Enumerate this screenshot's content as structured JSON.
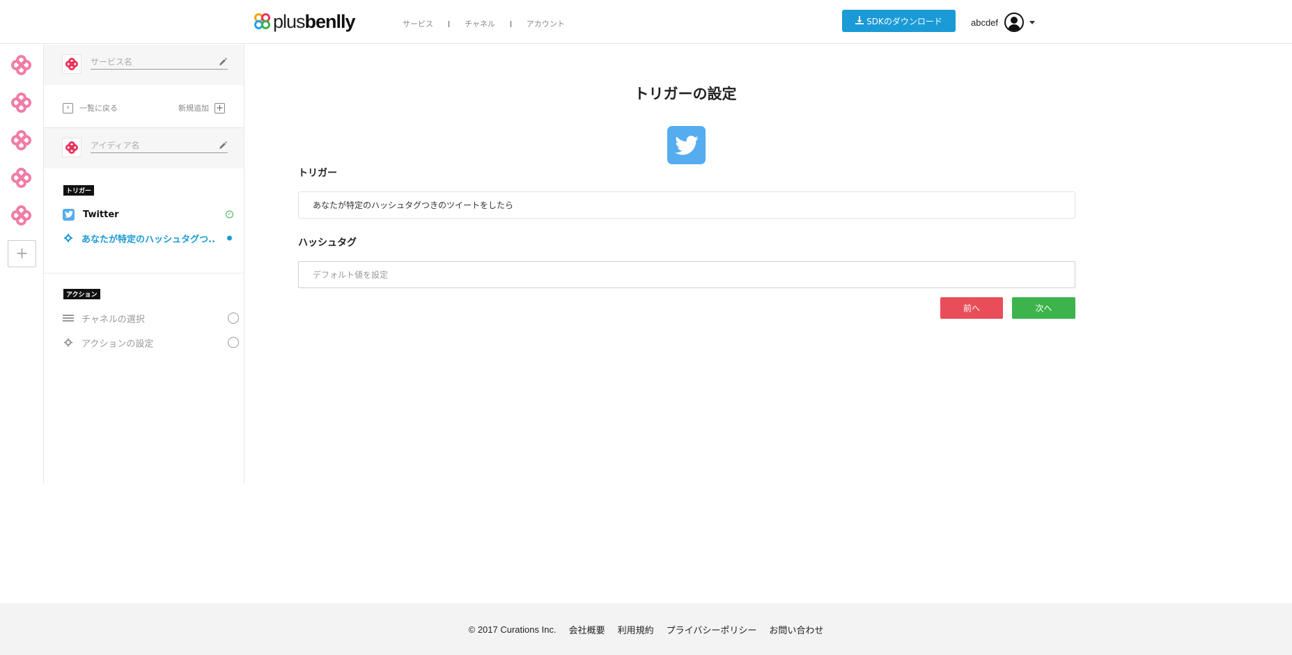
{
  "header": {
    "logo_plus": "plus",
    "logo_benlly": "benlly",
    "nav": [
      "サービス",
      "チャネル",
      "アカウント"
    ],
    "sdk_button": "SDKのダウンロード",
    "username": "abcdef"
  },
  "sidebar": {
    "service_placeholder": "サービス名",
    "back_label": "一覧に戻る",
    "add_label": "新規追加",
    "idea_placeholder": "アイディア名",
    "trigger_badge": "トリガー",
    "trigger_steps": [
      {
        "label": "Twitter",
        "status": "done"
      },
      {
        "label": "あなたが特定のハッシュタグつ..",
        "status": "active"
      }
    ],
    "action_badge": "アクション",
    "action_steps": [
      {
        "label": "チャネルの選択",
        "status": "pending"
      },
      {
        "label": "アクションの設定",
        "status": "pending"
      }
    ]
  },
  "main": {
    "title": "トリガーの設定",
    "trigger_label": "トリガー",
    "trigger_value": "あなたが特定のハッシュタグつきのツイートをしたら",
    "hashtag_label": "ハッシュタグ",
    "hashtag_placeholder": "デフォルト値を設定",
    "prev_button": "前へ",
    "next_button": "次へ"
  },
  "footer": {
    "copyright": "© 2017 Curations Inc.",
    "links": [
      "会社概要",
      "利用規約",
      "プライバシーポリシー",
      "お問い合わせ"
    ]
  },
  "colors": {
    "primary": "#1a9ad6",
    "danger": "#e84e5a",
    "success": "#3cb44b",
    "twitter": "#55acee",
    "brand_pink": "#f07ca6"
  }
}
